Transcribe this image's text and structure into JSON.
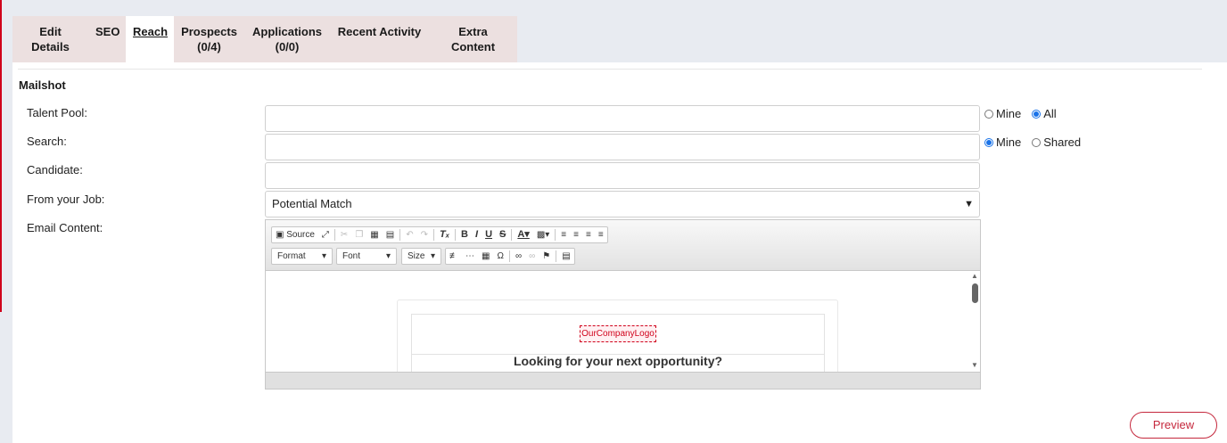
{
  "tabs": [
    {
      "line1": "Edit Details",
      "line2": ""
    },
    {
      "line1": "SEO",
      "line2": ""
    },
    {
      "line1": "Reach",
      "line2": ""
    },
    {
      "line1": "Prospects",
      "line2": "(0/4)"
    },
    {
      "line1": "Applications",
      "line2": "(0/0)"
    },
    {
      "line1": "Recent Activity",
      "line2": ""
    },
    {
      "line1": "Extra Content",
      "line2": ""
    }
  ],
  "active_tab": "Reach",
  "section_title": "Mailshot",
  "form": {
    "talent_pool_label": "Talent Pool:",
    "talent_pool_value": "",
    "talent_pool_options": {
      "mine": "Mine",
      "all": "All"
    },
    "search_label": "Search:",
    "search_value": "",
    "search_options": {
      "mine": "Mine",
      "shared": "Shared"
    },
    "candidate_label": "Candidate:",
    "candidate_value": "",
    "job_label": "From your Job:",
    "job_selected": "Potential Match",
    "email_label": "Email Content:"
  },
  "editor": {
    "source_label": "Source",
    "format_label": "Format",
    "font_label": "Font",
    "size_label": "Size",
    "logo_text": "OurCompanyLogo",
    "headline": "Looking for your next opportunity?"
  },
  "preview_label": "Preview",
  "colors": {
    "accent": "#c5283d",
    "radio": "#1a73e8",
    "tab_bg": "#ece0e0",
    "page_bg": "#e8ebf1"
  }
}
